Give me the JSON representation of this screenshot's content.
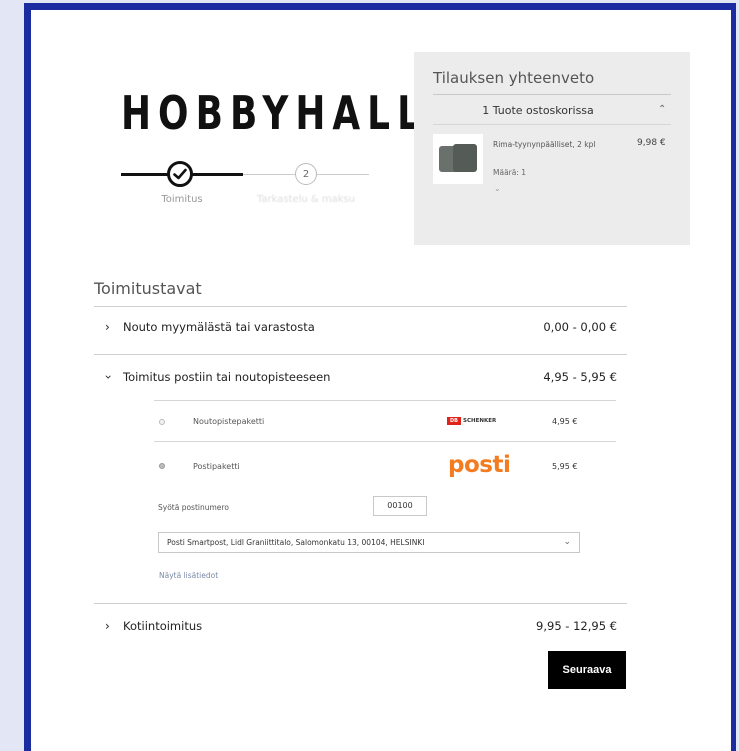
{
  "brand": {
    "logo_text": "HOBBYHALL"
  },
  "stepper": {
    "step1_label": "Toimitus",
    "step2_number": "2",
    "step2_label": "Tarkastelu & maksu"
  },
  "summary": {
    "title": "Tilauksen yhteenveto",
    "count_label": "1 Tuote ostoskorissa",
    "toggle_icon": "chevron-up-icon",
    "product": {
      "name": "Rima-tyynynpäälliset, 2 kpl",
      "quantity": "Määrä: 1",
      "price": "9,98 €"
    }
  },
  "delivery": {
    "title": "Toimitustavat",
    "options": [
      {
        "label": "Nouto myymälästä tai varastosta",
        "price": "0,00 - 0,00 €",
        "expanded": false
      },
      {
        "label": "Toimitus postiin tai noutopisteeseen",
        "price": "4,95 - 5,95 €",
        "expanded": true
      },
      {
        "label": "Kotiintoimitus",
        "price": "9,95 - 12,95 €",
        "expanded": false
      }
    ],
    "sub_options": [
      {
        "label": "Noutopistepaketti",
        "carrier": "DB SCHENKER",
        "price": "4,95 €",
        "selected": false
      },
      {
        "label": "Postipaketti",
        "carrier": "posti",
        "price": "5,95 €",
        "selected": true
      }
    ],
    "postcode_label": "Syötä postinumero",
    "postcode_value": "00100",
    "pickup_point": "Posti Smartpost, Lidl Graniittitalo, Salomonkatu 13, 00104, HELSINKI",
    "more_info_link": "Näytä lisätiedot",
    "next_button": "Seuraava"
  },
  "colors": {
    "frame": "#1a2ca0",
    "posti_orange": "#f47c20",
    "schenker_red": "#e2231a",
    "button": "#000000"
  }
}
